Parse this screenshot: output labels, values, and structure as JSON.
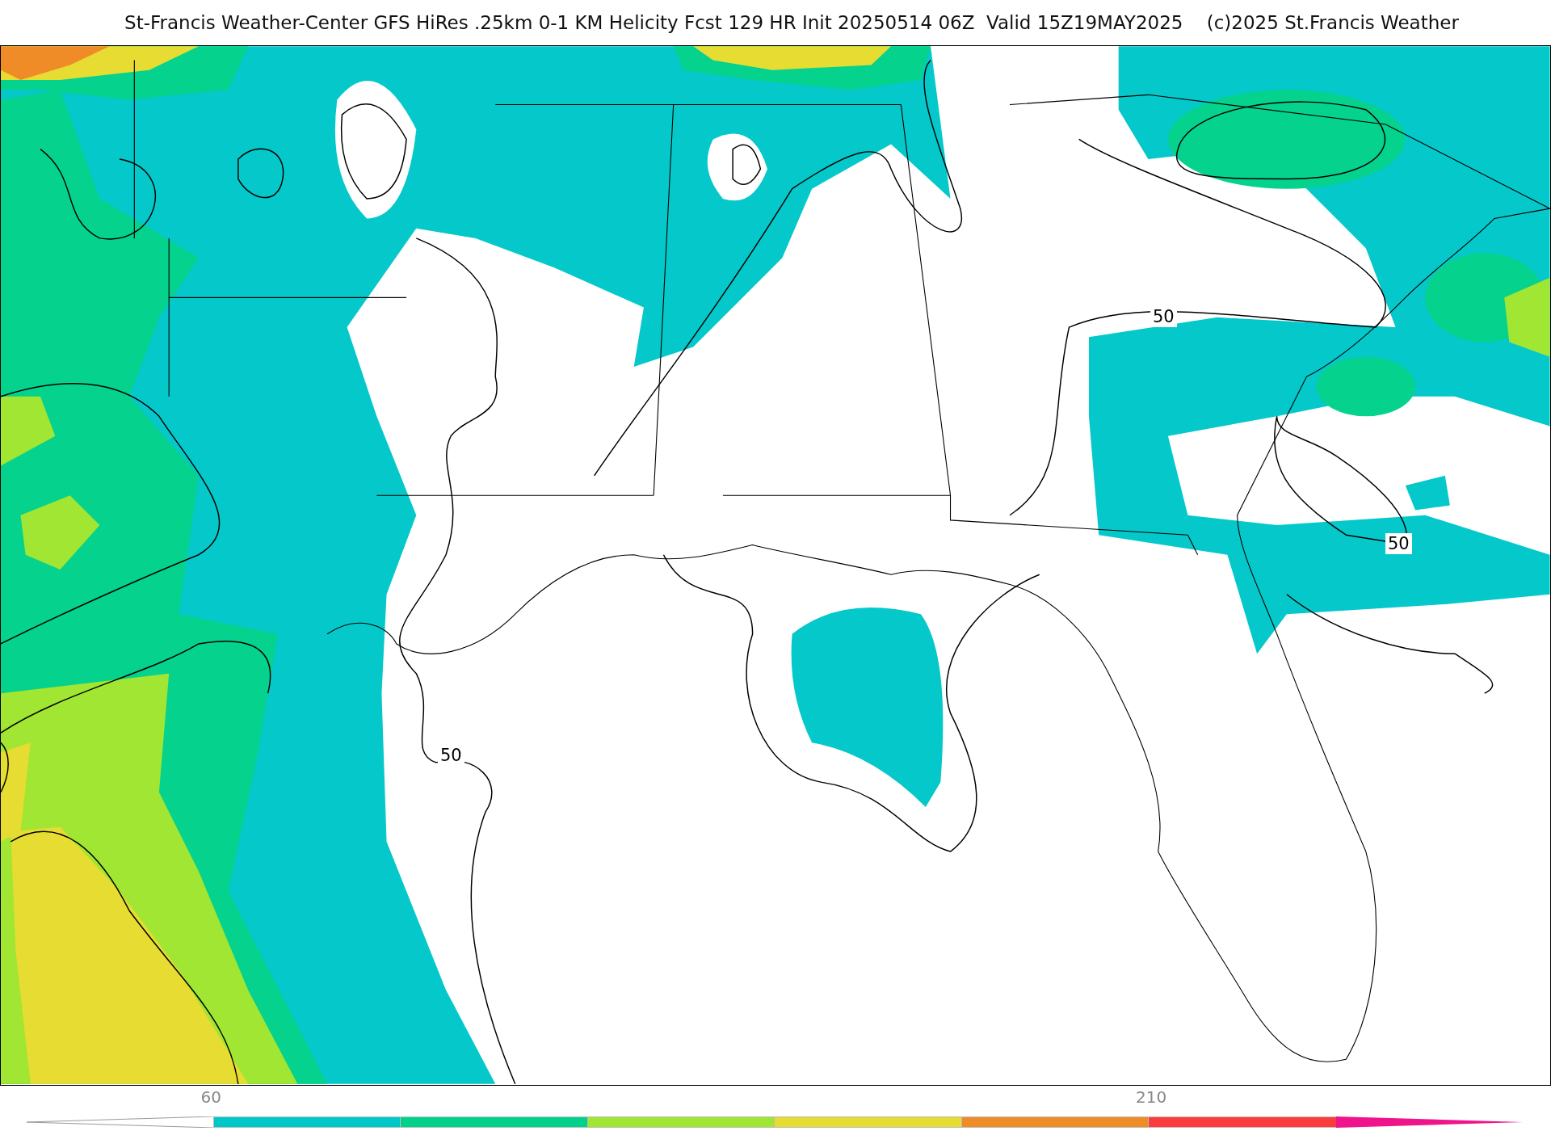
{
  "title": "St-Francis Weather-Center GFS HiRes .25km 0-1 KM Helicity Fcst 129 HR Init 20250514 06Z  Valid 15Z19MAY2025    (c)2025 St.Francis Weather",
  "map": {
    "contour_labels": [
      "50",
      "50",
      "50"
    ]
  },
  "colorbar": {
    "segments": [
      {
        "kind": "arrow-low",
        "color": "#ffffff"
      },
      {
        "kind": "band",
        "color": "#00c8c8",
        "tick": "60"
      },
      {
        "kind": "band",
        "color": "#00d28c"
      },
      {
        "kind": "band",
        "color": "#a0e632"
      },
      {
        "kind": "band",
        "color": "#e6dc32"
      },
      {
        "kind": "band",
        "color": "#f08c28"
      },
      {
        "kind": "band",
        "color": "#fa3c3c",
        "tick": "210"
      },
      {
        "kind": "arrow-high",
        "color": "#f0148c"
      }
    ]
  }
}
